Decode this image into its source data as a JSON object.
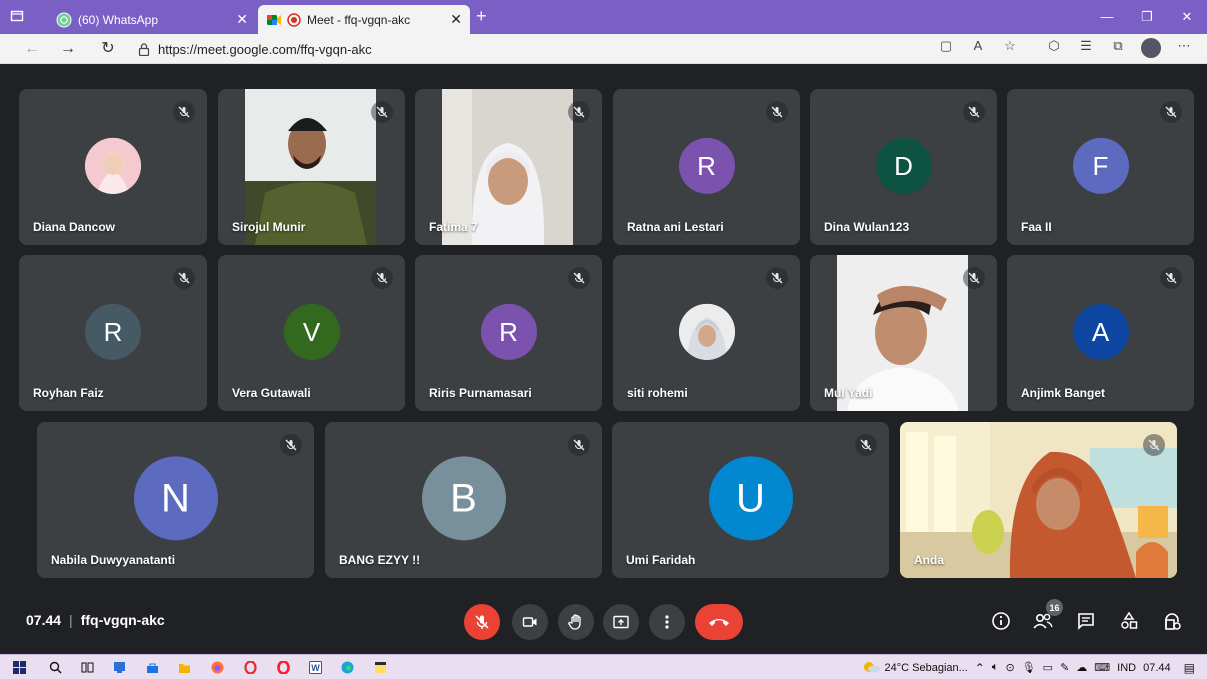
{
  "browser": {
    "tabs": [
      {
        "title": "(60) WhatsApp",
        "active": false
      },
      {
        "title": "Meet - ffq-vgqn-akc",
        "active": true
      }
    ],
    "new_tab_label": "+",
    "url": "https://meet.google.com/ffq-vgqn-akc",
    "window_controls": [
      "minimize",
      "restore",
      "close"
    ],
    "accent_color": "#7a5fc4"
  },
  "participants": [
    {
      "name": "Diana Dancow",
      "kind": "photo",
      "muted": true
    },
    {
      "name": "Sirojul Munir",
      "kind": "video",
      "muted": true
    },
    {
      "name": "Fatima 7",
      "kind": "video",
      "muted": true
    },
    {
      "name": "Ratna ani Lestari",
      "initial": "R",
      "color": "#7b52ae",
      "muted": true
    },
    {
      "name": "Dina Wulan123",
      "initial": "D",
      "color": "#0e5241",
      "muted": true
    },
    {
      "name": "Faa II",
      "initial": "F",
      "color": "#5c6bc0",
      "muted": true
    },
    {
      "name": "Royhan Faiz",
      "initial": "R",
      "color": "#455a64",
      "muted": true
    },
    {
      "name": "Vera Gutawali",
      "initial": "V",
      "color": "#33691e",
      "muted": true
    },
    {
      "name": "Riris Purnamasari",
      "initial": "R",
      "color": "#7b52ae",
      "muted": true
    },
    {
      "name": "siti rohemi",
      "kind": "photo",
      "muted": true
    },
    {
      "name": "Mul Yadi",
      "kind": "video",
      "muted": true
    },
    {
      "name": "Anjimk Banget",
      "initial": "A",
      "color": "#0d47a1",
      "muted": true
    },
    {
      "name": "Nabila Duwyyanatanti",
      "initial": "N",
      "color": "#5c6bc0",
      "muted": true
    },
    {
      "name": "BANG EZYY !!",
      "initial": "B",
      "color": "#78909c",
      "muted": true
    },
    {
      "name": "Umi Faridah",
      "initial": "U",
      "color": "#0288d1",
      "muted": true
    },
    {
      "name": "Anda",
      "kind": "video",
      "muted": true
    }
  ],
  "meeting": {
    "time": "07.44",
    "separator": "|",
    "code": "ffq-vgqn-akc",
    "controls": [
      "mic-off",
      "camera",
      "raise-hand",
      "present",
      "more-options",
      "leave-call"
    ],
    "right_controls": [
      "meeting-details",
      "people",
      "chat",
      "activities",
      "host-controls"
    ],
    "people_count": "16",
    "end_call_color": "#ea4335"
  },
  "taskbar": {
    "apps": [
      "start",
      "search",
      "task-view",
      "app-1",
      "store",
      "file-explorer",
      "firefox",
      "opera-gx",
      "opera",
      "word",
      "edge",
      "sticky-notes"
    ],
    "weather": "24°C  Sebagian...",
    "language": "IND",
    "clock": "07.44"
  }
}
